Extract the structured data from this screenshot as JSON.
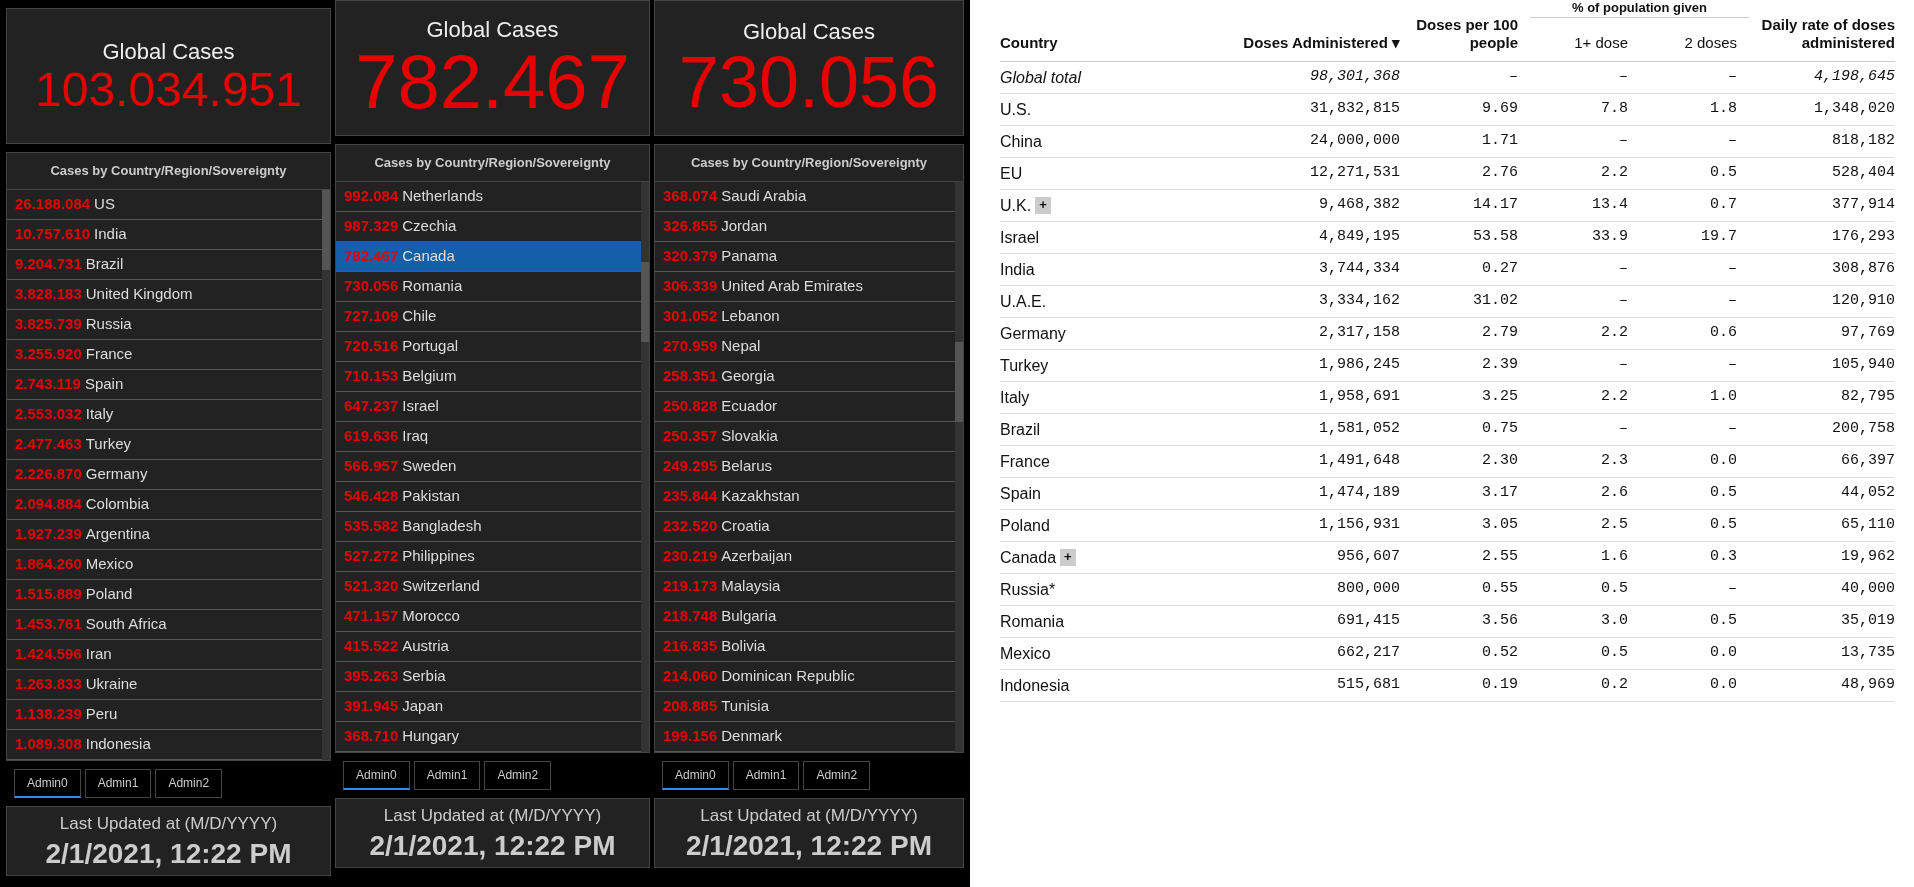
{
  "dashboards": [
    {
      "global_title": "Global Cases",
      "global_value": "103.034.951",
      "list_title": "Cases by Country/Region/Sovereignty",
      "rows": [
        {
          "value": "26.188.084",
          "name": "US",
          "selected": false
        },
        {
          "value": "10.757.610",
          "name": "India",
          "selected": false
        },
        {
          "value": "9.204.731",
          "name": "Brazil",
          "selected": false
        },
        {
          "value": "3.828.183",
          "name": "United Kingdom",
          "selected": false
        },
        {
          "value": "3.825.739",
          "name": "Russia",
          "selected": false
        },
        {
          "value": "3.255.920",
          "name": "France",
          "selected": false
        },
        {
          "value": "2.743.119",
          "name": "Spain",
          "selected": false
        },
        {
          "value": "2.553.032",
          "name": "Italy",
          "selected": false
        },
        {
          "value": "2.477.463",
          "name": "Turkey",
          "selected": false
        },
        {
          "value": "2.226.870",
          "name": "Germany",
          "selected": false
        },
        {
          "value": "2.094.884",
          "name": "Colombia",
          "selected": false
        },
        {
          "value": "1.927.239",
          "name": "Argentina",
          "selected": false
        },
        {
          "value": "1.864.260",
          "name": "Mexico",
          "selected": false
        },
        {
          "value": "1.515.889",
          "name": "Poland",
          "selected": false
        },
        {
          "value": "1.453.761",
          "name": "South Africa",
          "selected": false
        },
        {
          "value": "1.424.596",
          "name": "Iran",
          "selected": false
        },
        {
          "value": "1.263.833",
          "name": "Ukraine",
          "selected": false
        },
        {
          "value": "1.138.239",
          "name": "Peru",
          "selected": false
        },
        {
          "value": "1.089.308",
          "name": "Indonesia",
          "selected": false
        }
      ],
      "tabs": [
        {
          "label": "Admin0",
          "selected": true
        },
        {
          "label": "Admin1",
          "selected": false
        },
        {
          "label": "Admin2",
          "selected": false
        }
      ],
      "updated_label": "Last Updated at (M/D/YYYY)",
      "updated_value": "2/1/2021, 12:22 PM"
    },
    {
      "global_title": "Global Cases",
      "global_value": "782.467",
      "list_title": "Cases by Country/Region/Sovereignty",
      "rows": [
        {
          "value": "992.084",
          "name": "Netherlands",
          "selected": false
        },
        {
          "value": "987.329",
          "name": "Czechia",
          "selected": false
        },
        {
          "value": "782.467",
          "name": "Canada",
          "selected": true
        },
        {
          "value": "730.056",
          "name": "Romania",
          "selected": false
        },
        {
          "value": "727.109",
          "name": "Chile",
          "selected": false
        },
        {
          "value": "720.516",
          "name": "Portugal",
          "selected": false
        },
        {
          "value": "710.153",
          "name": "Belgium",
          "selected": false
        },
        {
          "value": "647.237",
          "name": "Israel",
          "selected": false
        },
        {
          "value": "619.636",
          "name": "Iraq",
          "selected": false
        },
        {
          "value": "566.957",
          "name": "Sweden",
          "selected": false
        },
        {
          "value": "546.428",
          "name": "Pakistan",
          "selected": false
        },
        {
          "value": "535.582",
          "name": "Bangladesh",
          "selected": false
        },
        {
          "value": "527.272",
          "name": "Philippines",
          "selected": false
        },
        {
          "value": "521.320",
          "name": "Switzerland",
          "selected": false
        },
        {
          "value": "471.157",
          "name": "Morocco",
          "selected": false
        },
        {
          "value": "415.522",
          "name": "Austria",
          "selected": false
        },
        {
          "value": "395.263",
          "name": "Serbia",
          "selected": false
        },
        {
          "value": "391.945",
          "name": "Japan",
          "selected": false
        },
        {
          "value": "368.710",
          "name": "Hungary",
          "selected": false
        }
      ],
      "tabs": [
        {
          "label": "Admin0",
          "selected": true
        },
        {
          "label": "Admin1",
          "selected": false
        },
        {
          "label": "Admin2",
          "selected": false
        }
      ],
      "updated_label": "Last Updated at (M/D/YYYY)",
      "updated_value": "2/1/2021, 12:22 PM"
    },
    {
      "global_title": "Global Cases",
      "global_value": "730.056",
      "list_title": "Cases by Country/Region/Sovereignty",
      "rows": [
        {
          "value": "368.074",
          "name": "Saudi Arabia",
          "selected": false
        },
        {
          "value": "326.855",
          "name": "Jordan",
          "selected": false
        },
        {
          "value": "320.379",
          "name": "Panama",
          "selected": false
        },
        {
          "value": "306.339",
          "name": "United Arab Emirates",
          "selected": false
        },
        {
          "value": "301.052",
          "name": "Lebanon",
          "selected": false
        },
        {
          "value": "270.959",
          "name": "Nepal",
          "selected": false
        },
        {
          "value": "258.351",
          "name": "Georgia",
          "selected": false
        },
        {
          "value": "250.828",
          "name": "Ecuador",
          "selected": false
        },
        {
          "value": "250.357",
          "name": "Slovakia",
          "selected": false
        },
        {
          "value": "249.295",
          "name": "Belarus",
          "selected": false
        },
        {
          "value": "235.844",
          "name": "Kazakhstan",
          "selected": false
        },
        {
          "value": "232.520",
          "name": "Croatia",
          "selected": false
        },
        {
          "value": "230.219",
          "name": "Azerbaijan",
          "selected": false
        },
        {
          "value": "219.173",
          "name": "Malaysia",
          "selected": false
        },
        {
          "value": "218.748",
          "name": "Bulgaria",
          "selected": false
        },
        {
          "value": "216.835",
          "name": "Bolivia",
          "selected": false
        },
        {
          "value": "214.060",
          "name": "Dominican Republic",
          "selected": false
        },
        {
          "value": "208.885",
          "name": "Tunisia",
          "selected": false
        },
        {
          "value": "199.156",
          "name": "Denmark",
          "selected": false
        }
      ],
      "tabs": [
        {
          "label": "Admin0",
          "selected": true
        },
        {
          "label": "Admin1",
          "selected": false
        },
        {
          "label": "Admin2",
          "selected": false
        }
      ],
      "updated_label": "Last Updated at (M/D/YYYY)",
      "updated_value": "2/1/2021, 12:22 PM"
    }
  ],
  "vaccine_table": {
    "group_header": "% of population given",
    "columns": [
      {
        "label": "Country"
      },
      {
        "label": "Doses Administered ▾"
      },
      {
        "label": "Doses per 100 people"
      },
      {
        "label": "1+ dose"
      },
      {
        "label": "2 doses"
      },
      {
        "label": "Daily rate of doses administered"
      }
    ],
    "rows": [
      {
        "kind": "total",
        "cells": [
          "Global total",
          "98,301,368",
          "–",
          "–",
          "–",
          "4,198,645"
        ]
      },
      {
        "kind": "country",
        "cells": [
          "U.S.",
          "31,832,815",
          "9.69",
          "7.8",
          "1.8",
          "1,348,020"
        ]
      },
      {
        "kind": "country",
        "cells": [
          "China",
          "24,000,000",
          "1.71",
          "–",
          "–",
          "818,182"
        ]
      },
      {
        "kind": "country",
        "cells": [
          "EU",
          "12,271,531",
          "2.76",
          "2.2",
          "0.5",
          "528,404"
        ]
      },
      {
        "kind": "country",
        "badge": "+",
        "cells": [
          "U.K.",
          "9,468,382",
          "14.17",
          "13.4",
          "0.7",
          "377,914"
        ]
      },
      {
        "kind": "country",
        "cells": [
          "Israel",
          "4,849,195",
          "53.58",
          "33.9",
          "19.7",
          "176,293"
        ]
      },
      {
        "kind": "country",
        "cells": [
          "India",
          "3,744,334",
          "0.27",
          "–",
          "–",
          "308,876"
        ]
      },
      {
        "kind": "country",
        "cells": [
          "U.A.E.",
          "3,334,162",
          "31.02",
          "–",
          "–",
          "120,910"
        ]
      },
      {
        "kind": "country",
        "cells": [
          "Germany",
          "2,317,158",
          "2.79",
          "2.2",
          "0.6",
          "97,769"
        ]
      },
      {
        "kind": "country",
        "cells": [
          "Turkey",
          "1,986,245",
          "2.39",
          "–",
          "–",
          "105,940"
        ]
      },
      {
        "kind": "country",
        "cells": [
          "Italy",
          "1,958,691",
          "3.25",
          "2.2",
          "1.0",
          "82,795"
        ]
      },
      {
        "kind": "country",
        "cells": [
          "Brazil",
          "1,581,052",
          "0.75",
          "–",
          "–",
          "200,758"
        ]
      },
      {
        "kind": "country",
        "cells": [
          "France",
          "1,491,648",
          "2.30",
          "2.3",
          "0.0",
          "66,397"
        ]
      },
      {
        "kind": "country",
        "cells": [
          "Spain",
          "1,474,189",
          "3.17",
          "2.6",
          "0.5",
          "44,052"
        ]
      },
      {
        "kind": "country",
        "cells": [
          "Poland",
          "1,156,931",
          "3.05",
          "2.5",
          "0.5",
          "65,110"
        ]
      },
      {
        "kind": "country",
        "badge": "+",
        "cells": [
          "Canada",
          "956,607",
          "2.55",
          "1.6",
          "0.3",
          "19,962"
        ]
      },
      {
        "kind": "country",
        "cells": [
          "Russia*",
          "800,000",
          "0.55",
          "0.5",
          "–",
          "40,000"
        ]
      },
      {
        "kind": "country",
        "cells": [
          "Romania",
          "691,415",
          "3.56",
          "3.0",
          "0.5",
          "35,019"
        ]
      },
      {
        "kind": "country",
        "cells": [
          "Mexico",
          "662,217",
          "0.52",
          "0.5",
          "0.0",
          "13,735"
        ]
      },
      {
        "kind": "country",
        "cells": [
          "Indonesia",
          "515,681",
          "0.19",
          "0.2",
          "0.0",
          "48,969"
        ]
      }
    ]
  }
}
